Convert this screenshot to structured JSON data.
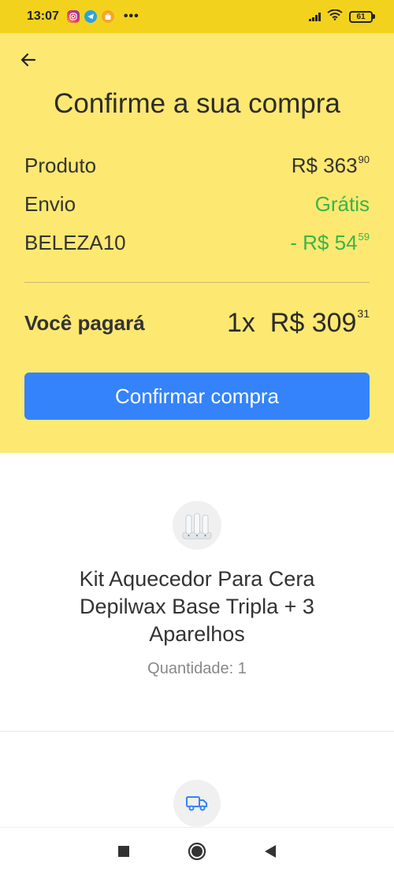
{
  "status_bar": {
    "time": "13:07",
    "battery": "61",
    "more": "•••"
  },
  "header": {
    "title": "Confirme a sua compra"
  },
  "summary": {
    "product": {
      "label": "Produto",
      "amount": "R$ 363",
      "cents": "90"
    },
    "shipping": {
      "label": "Envio",
      "value": "Grátis"
    },
    "coupon": {
      "label": "BELEZA10",
      "amount": "- R$ 54",
      "cents": "59"
    },
    "total": {
      "label": "Você pagará",
      "installments": "1x",
      "amount": "R$ 309",
      "cents": "31"
    }
  },
  "confirm_button": "Confirmar compra",
  "product": {
    "name": "Kit Aquecedor Para Cera Depilwax Base Tripla + 3 Aparelhos",
    "quantity": "Quantidade: 1"
  },
  "icons": {
    "back": "arrow-left-icon",
    "shipping": "truck-icon"
  },
  "colors": {
    "status_bar": "#f2d21d",
    "panel": "#fde871",
    "button": "#3483fa",
    "success": "#39b54a"
  }
}
